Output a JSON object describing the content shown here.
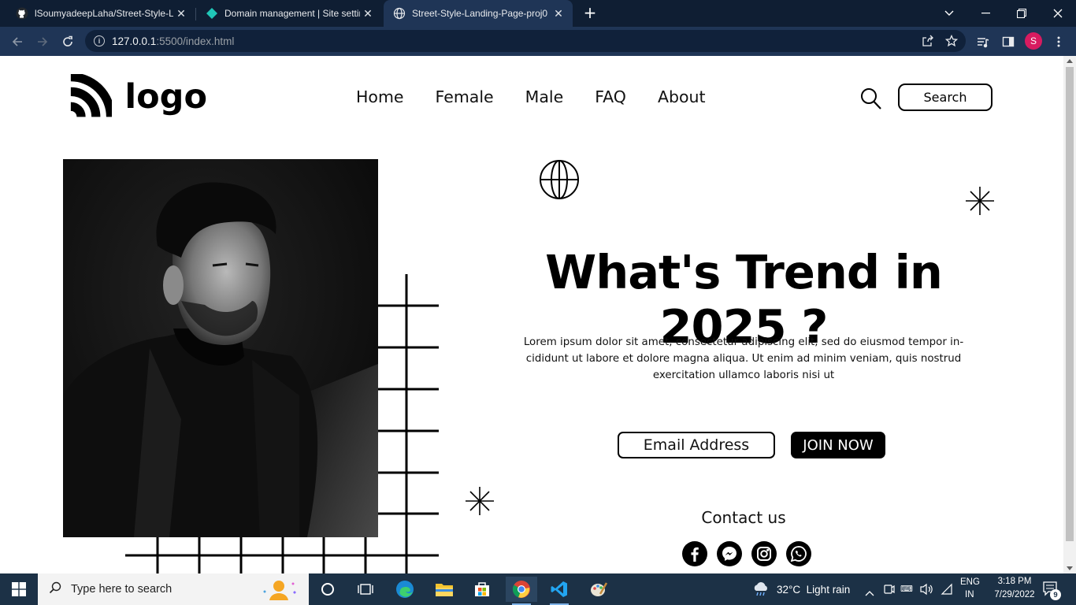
{
  "browser": {
    "tabs": [
      {
        "title": "lSoumyadeepLaha/Street-Style-L",
        "icon": "github-icon",
        "active": false
      },
      {
        "title": "Domain management | Site settin",
        "icon": "netlify-icon",
        "active": false
      },
      {
        "title": "Street-Style-Landing-Page-proj0",
        "icon": "globe-icon",
        "active": true
      }
    ],
    "url_host": "127.0.0.1",
    "url_path": ":5500/index.html",
    "profile_initial": "S"
  },
  "site": {
    "logo_text": "logo",
    "nav": [
      "Home",
      "Female",
      "Male",
      "FAQ",
      "About"
    ],
    "search_label": "Search",
    "hero_title": "What's Trend in 2025 ?",
    "hero_desc": "Lorem ipsum dolor sit amet, consectetur adipiscing elit, sed do eiusmod tempor in-cididunt ut labore et dolore magna aliqua. Ut enim ad minim veniam, quis nostrud exercitation ullamco laboris nisi ut",
    "email_placeholder": "Email Address",
    "join_label": "JOIN NOW",
    "contact_label": "Contact us",
    "socials": [
      "facebook-icon",
      "messenger-icon",
      "instagram-icon",
      "whatsapp-icon"
    ]
  },
  "taskbar": {
    "search_placeholder": "Type here to search",
    "weather": "32°C  Light rain",
    "lang_top": "ENG",
    "lang_bottom": "IN",
    "time": "3:18 PM",
    "date": "7/29/2022",
    "notification_count": "9"
  }
}
